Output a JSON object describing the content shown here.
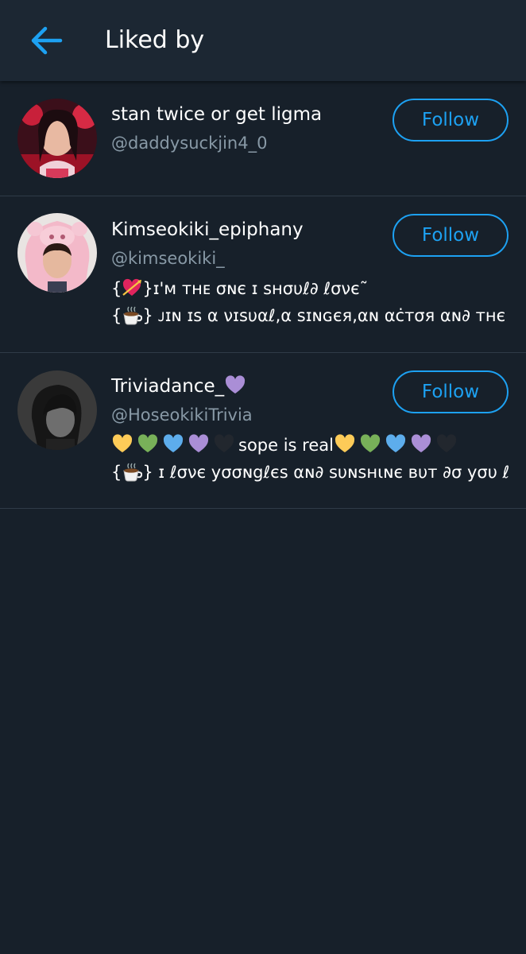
{
  "header": {
    "title": "Liked by",
    "back_icon": "arrow-left-icon"
  },
  "users": [
    {
      "name": "stan twice or get ligma",
      "handle": "@daddysuckjin4_0",
      "follow_label": "Follow",
      "bio": []
    },
    {
      "name": "Kimseokiki_epiphany",
      "handle": "@kimseokiki_",
      "follow_label": "Follow",
      "bio": [
        {
          "prefix": "{",
          "icon": "heart-arrow-icon",
          "text": "}ɪ'ᴍ ᴛʜᴇ σɴє ɪ sʜσυℓ∂ ℓσνє˜"
        },
        {
          "prefix": "{",
          "icon": "coffee-icon",
          "text": "} ᴊɪɴ ɪs α νɪsυαℓ,α sɪɴɢєя,αɴ αċтσя αɴ∂ тнє мσ..."
        }
      ]
    },
    {
      "name": "Triviadance_",
      "handle": "@HoseokikiTrivia",
      "follow_label": "Follow",
      "name_suffix_icon": "purple-heart-icon",
      "bio": [
        {
          "text": "sope is real"
        },
        {
          "prefix": "{",
          "icon": "coffee-icon",
          "text": "} ɪ ℓσνє yσσɴgℓєs αɴ∂ sυɴsнιɴє вυт ∂σ yσυ ℓ..."
        }
      ]
    }
  ],
  "colors": {
    "background": "#17202a",
    "header": "#1c2733",
    "accent": "#1da1f2",
    "secondary_text": "#8899a6",
    "divider": "#2f3b47"
  }
}
